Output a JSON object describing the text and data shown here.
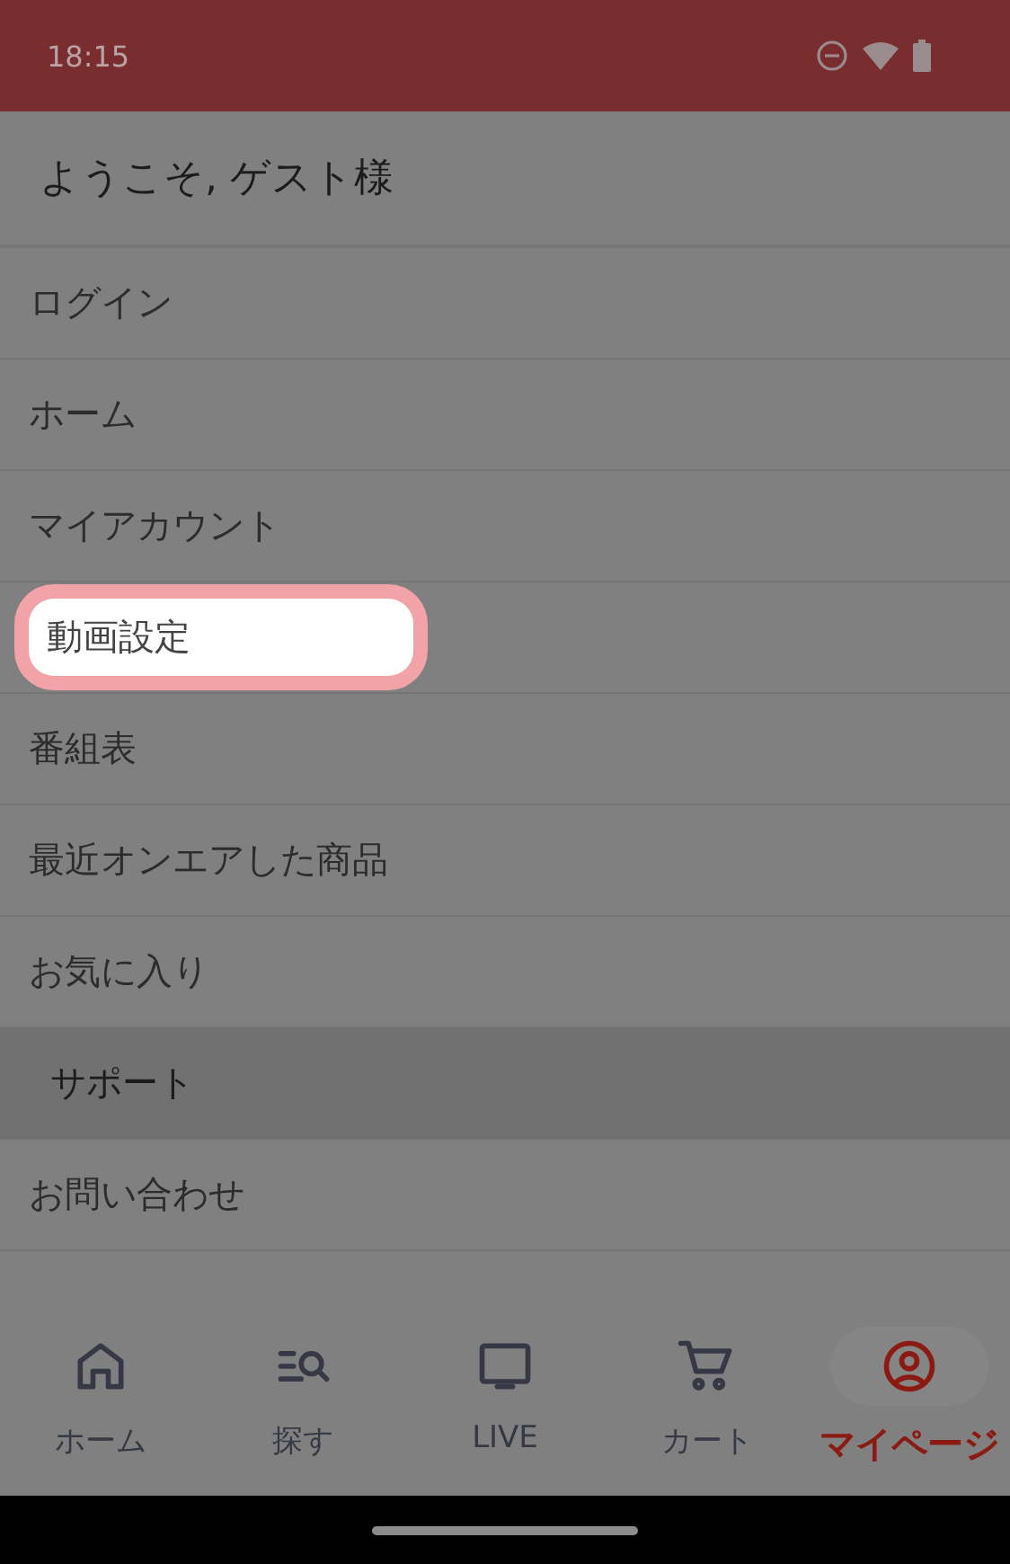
{
  "status_bar": {
    "time": "18:15"
  },
  "greeting": "ようこそ, ゲスト様",
  "menu": [
    {
      "kind": "item",
      "label": "ログイン",
      "highlighted": false
    },
    {
      "kind": "item",
      "label": "ホーム",
      "highlighted": false
    },
    {
      "kind": "item",
      "label": "マイアカウント",
      "highlighted": false
    },
    {
      "kind": "item",
      "label": "動画設定",
      "highlighted": true
    },
    {
      "kind": "item",
      "label": "番組表",
      "highlighted": false
    },
    {
      "kind": "item",
      "label": "最近オンエアした商品",
      "highlighted": false
    },
    {
      "kind": "item",
      "label": "お気に入り",
      "highlighted": false
    },
    {
      "kind": "section",
      "label": "サポート",
      "highlighted": false
    },
    {
      "kind": "item",
      "label": "お問い合わせ",
      "highlighted": false
    }
  ],
  "bottom_nav": [
    {
      "label": "ホーム",
      "selected": false
    },
    {
      "label": "探す",
      "selected": false
    },
    {
      "label": "LIVE",
      "selected": false
    },
    {
      "label": "カート",
      "selected": false
    },
    {
      "label": "マイページ",
      "selected": true
    }
  ]
}
